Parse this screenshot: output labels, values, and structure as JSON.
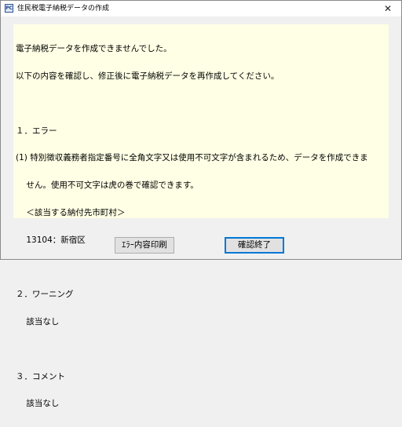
{
  "window": {
    "title": "住民税電子納税データの作成",
    "icon_text": "PC",
    "close_glyph": "✕"
  },
  "message": {
    "lines": [
      "電子納税データを作成できませんでした。",
      "以下の内容を確認し、修正後に電子納税データを再作成してください。",
      "",
      "１．エラー",
      "(1) 特別徴収義務者指定番号に全角文字又は使用不可文字が含まれるため、データを作成できま",
      "    せん。使用不可文字は虎の巻で確認できます。",
      "    ＜該当する納付先市町村＞",
      "    13104：新宿区",
      "",
      "２．ワーニング",
      "    該当なし",
      "",
      "３．コメント",
      "    該当なし"
    ]
  },
  "buttons": {
    "print_label": "ｴﾗｰ内容印刷",
    "confirm_label": "確認終了"
  },
  "colors": {
    "content_bg": "#ffffe5",
    "window_bg": "#f0f0f0",
    "default_button_border": "#0078d7"
  }
}
